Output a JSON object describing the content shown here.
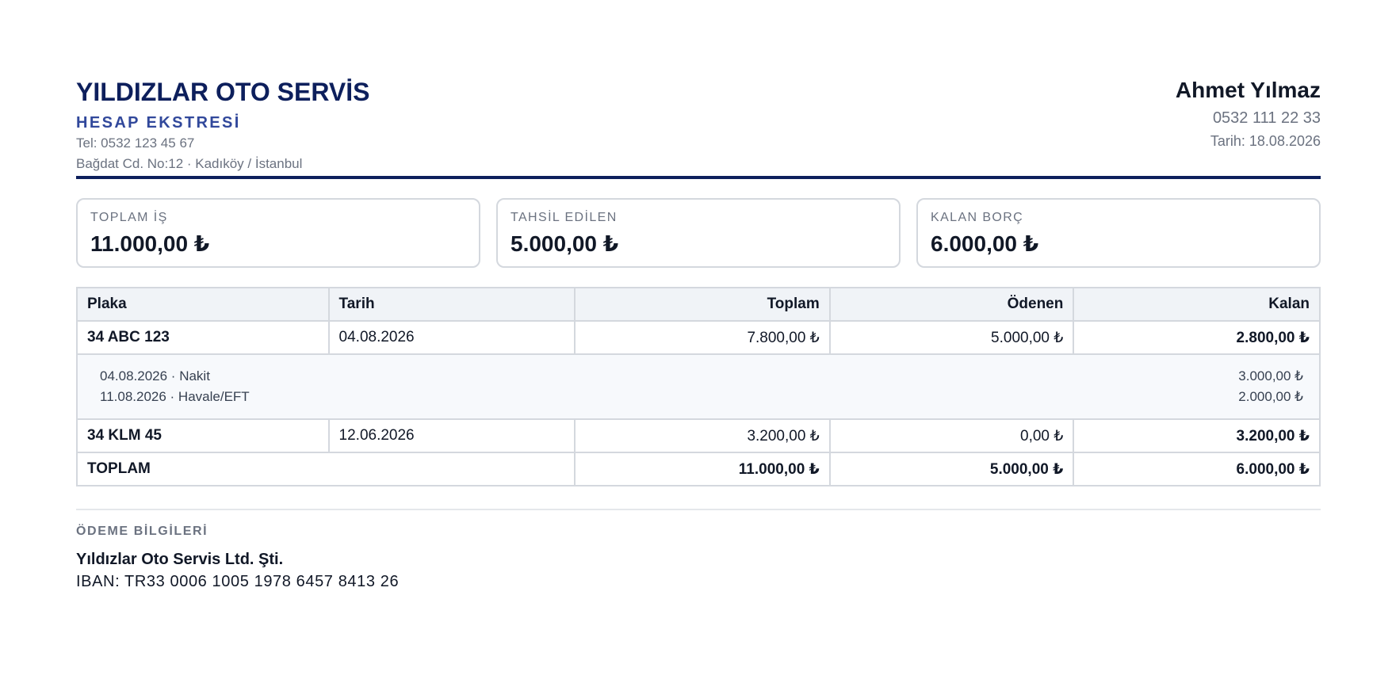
{
  "company": {
    "name": "YILDIZLAR OTO SERVİS",
    "doc_type": "HESAP EKSTRESİ",
    "phone": "Tel: 0532 123 45 67",
    "address": "Bağdat Cd. No:12 · Kadıköy / İstanbul"
  },
  "client": {
    "name": "Ahmet Yılmaz",
    "phone": "0532 111 22 33",
    "date": "Tarih: 18.08.2026"
  },
  "summary": [
    {
      "label": "TOPLAM İŞ",
      "value": "11.000,00 ₺"
    },
    {
      "label": "TAHSİL EDİLEN",
      "value": "5.000,00 ₺"
    },
    {
      "label": "KALAN BORÇ",
      "value": "6.000,00 ₺"
    }
  ],
  "table": {
    "headers": [
      "Plaka",
      "Tarih",
      "Toplam",
      "Ödenen",
      "Kalan"
    ],
    "rows": [
      {
        "plate": "34 ABC 123",
        "date": "04.08.2026",
        "total": "7.800,00 ₺",
        "paid": "5.000,00 ₺",
        "remaining": "2.800,00 ₺",
        "payments": [
          {
            "desc": "04.08.2026 · Nakit",
            "amount": "3.000,00 ₺"
          },
          {
            "desc": "11.08.2026 · Havale/EFT",
            "amount": "2.000,00 ₺"
          }
        ]
      },
      {
        "plate": "34 KLM 45",
        "date": "12.06.2026",
        "total": "3.200,00 ₺",
        "paid": "0,00 ₺",
        "remaining": "3.200,00 ₺",
        "payments": []
      }
    ],
    "totals": {
      "label": "TOPLAM",
      "total": "11.000,00 ₺",
      "paid": "5.000,00 ₺",
      "remaining": "6.000,00 ₺"
    }
  },
  "payment_info": {
    "label": "ÖDEME BİLGİLERİ",
    "company": "Yıldızlar Oto Servis Ltd. Şti.",
    "iban": "IBAN: TR33 0006 1005 1978 6457 8413 26"
  },
  "colors": {
    "brand_navy": "#0d1f5c",
    "accent_blue": "#31489b",
    "muted_text": "#6b7280",
    "border": "#d4d8de",
    "header_bg": "#f0f3f7"
  }
}
